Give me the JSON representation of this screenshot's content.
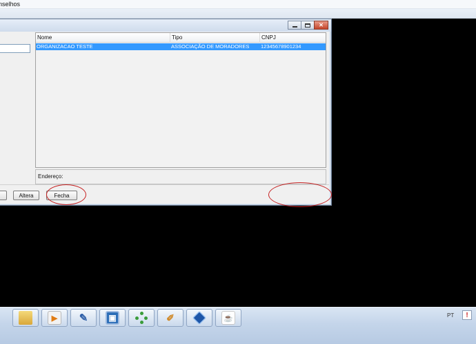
{
  "main_window": {
    "title": "nselhos"
  },
  "dialog": {
    "controls": {
      "minimize": "minimize-icon",
      "maximize": "maximize-icon",
      "close": "✕"
    },
    "list": {
      "columns": [
        "Nome",
        "Tipo",
        "CNPJ"
      ],
      "rows": [
        {
          "nome": "ORGANIZACAO TESTE",
          "tipo": "ASSOCIAÇÃO DE MORADORES",
          "cnpj": "12345678901234"
        }
      ],
      "selected_row_color": "#3399ff"
    },
    "address_label": "Endereço:",
    "buttons": {
      "altera": "Altera",
      "fecha": "Fecha"
    }
  },
  "annotations": {
    "color": "#c62020",
    "count": 2
  },
  "taskbar": {
    "apps": [
      {
        "name": "folder-icon"
      },
      {
        "name": "media-player-icon",
        "glyph": "▶"
      },
      {
        "name": "tools-icon",
        "glyph": "✎"
      },
      {
        "name": "remote-desktop-icon",
        "glyph": "▣"
      },
      {
        "name": "network-icon"
      },
      {
        "name": "paint-icon",
        "glyph": "✐"
      },
      {
        "name": "virtualbox-icon"
      },
      {
        "name": "java-icon",
        "glyph": "☕"
      }
    ],
    "language": "PT",
    "tray_flag": "!"
  }
}
